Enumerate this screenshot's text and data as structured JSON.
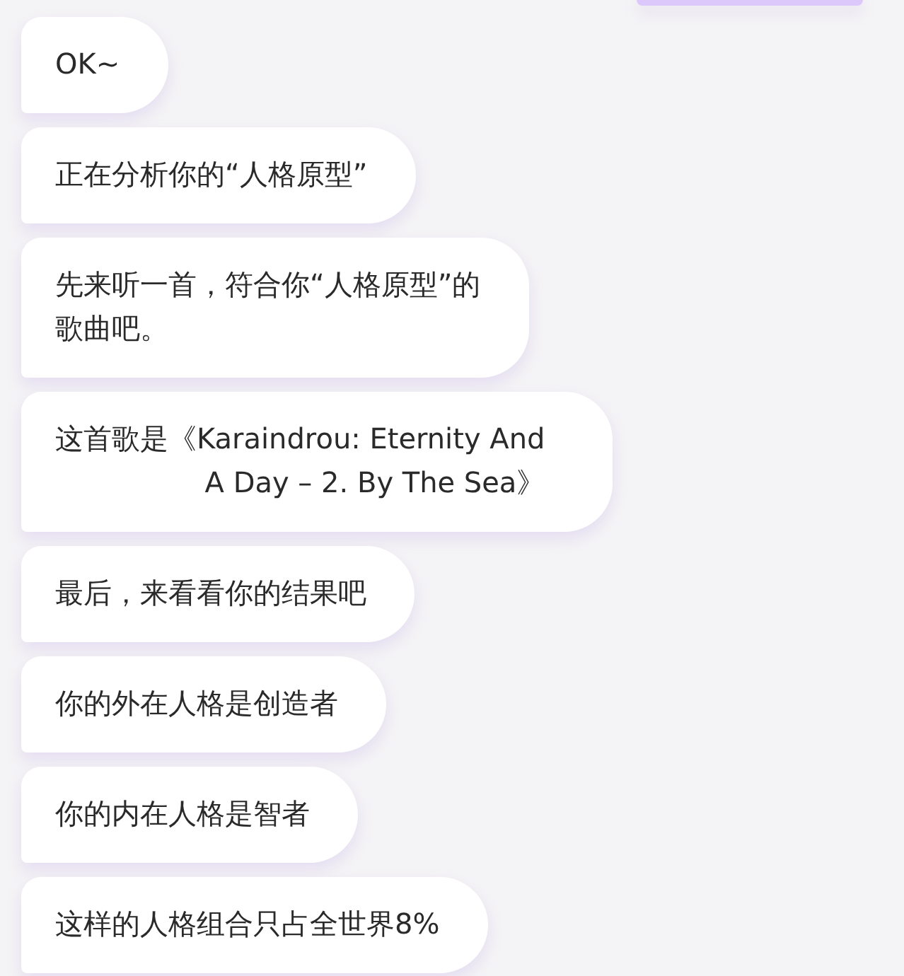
{
  "messages": [
    {
      "kind": "text",
      "lines": [
        "OK~"
      ]
    },
    {
      "kind": "text",
      "lines": [
        "正在分析你的“人格原型”"
      ]
    },
    {
      "kind": "text",
      "lines": [
        "先来听一首，符合你“人格原型”的",
        "歌曲吧。"
      ]
    },
    {
      "kind": "song",
      "lines": [
        "这首歌是《Karaindrou: Eternity And",
        "A Day – 2. By The Sea》"
      ]
    },
    {
      "kind": "text",
      "lines": [
        "最后，来看看你的结果吧"
      ]
    },
    {
      "kind": "text",
      "lines": [
        "你的外在人格是创造者"
      ]
    },
    {
      "kind": "text",
      "lines": [
        "你的内在人格是智者"
      ]
    },
    {
      "kind": "text",
      "lines": [
        "这样的人格组合只占全世界8%"
      ]
    }
  ]
}
